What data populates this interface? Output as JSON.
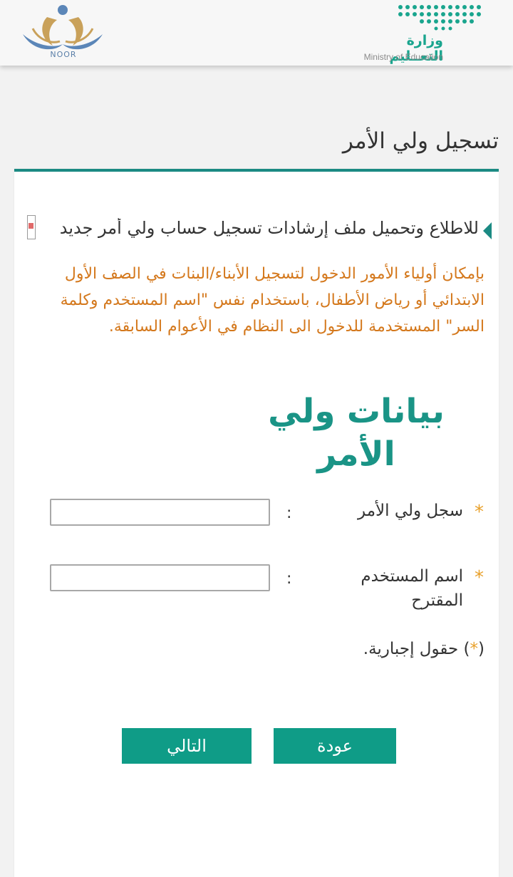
{
  "header": {
    "noor_logo_text": "NOOR",
    "ministry_name_ar": "وزارة التعــليم",
    "ministry_name_en": "Ministry of Education"
  },
  "page": {
    "title": "تسجيل ولي الأمر"
  },
  "guide_link": {
    "label": "للاطلاع وتحميل ملف إرشادات تسجيل حساب ولي أمر جديد"
  },
  "notice": {
    "text": "بإمكان أولياء الأمور الدخول لتسجيل الأبناء/البنات في الصف الأول الابتدائي أو رياض الأطفال، باستخدام نفس \"اسم المستخدم وكلمة السر\" المستخدمة للدخول الى النظام في الأعوام السابقة."
  },
  "form": {
    "section_title_line1": "بيانات ولي",
    "section_title_line2": "الأمر",
    "required_mark": "*",
    "colon": ":",
    "fields": [
      {
        "label": "سجل ولي الأمر",
        "value": ""
      },
      {
        "label_line1": "اسم المستخدم",
        "label_line2": "المقترح",
        "value": ""
      }
    ],
    "required_note_open": "(",
    "required_note_star": "*",
    "required_note_rest": ") حقول إجبارية."
  },
  "buttons": {
    "back_label": "عودة",
    "next_label": "التالي"
  },
  "colors": {
    "accent": "#0f9c87",
    "notice": "#d4781c",
    "required": "#e8a02a",
    "header_border": "#1b8a83"
  },
  "icons": [
    "noor-logo-icon",
    "moe-logo-icon",
    "caret-left-icon",
    "pdf-file-icon"
  ]
}
